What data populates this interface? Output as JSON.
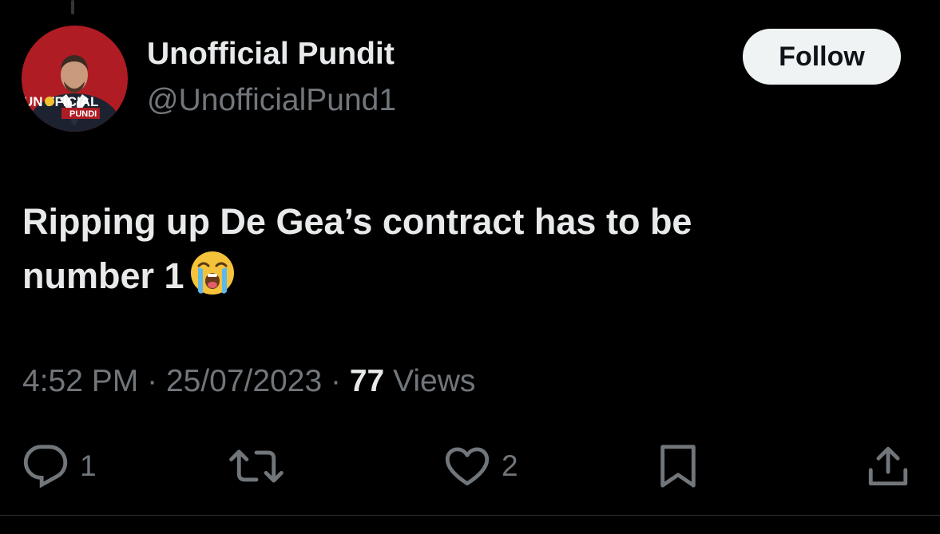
{
  "colors": {
    "background": "#000000",
    "primary_text": "#e7e9ea",
    "secondary_text": "#71767b",
    "follow_bg": "#eff3f4",
    "follow_text": "#0f1419",
    "avatar_red": "#b01c24"
  },
  "author": {
    "display_name": "Unofficial Pundit",
    "handle": "@UnofficialPund1",
    "avatar_logo_line1": "UN FFICIAL",
    "avatar_logo_line2": "PUNDI"
  },
  "follow_button": {
    "label": "Follow"
  },
  "tweet": {
    "text": "Ripping up De Gea’s contract has to be number 1",
    "emoji": "loudly-crying-face"
  },
  "meta": {
    "time": "4:52 PM",
    "date": "25/07/2023",
    "separator": "·",
    "views_count": "77",
    "views_label": "Views"
  },
  "actions": {
    "reply": {
      "icon": "reply-icon",
      "count": "1"
    },
    "retweet": {
      "icon": "retweet-icon"
    },
    "like": {
      "icon": "heart-icon",
      "count": "2"
    },
    "bookmark": {
      "icon": "bookmark-icon"
    },
    "share": {
      "icon": "share-icon"
    }
  }
}
